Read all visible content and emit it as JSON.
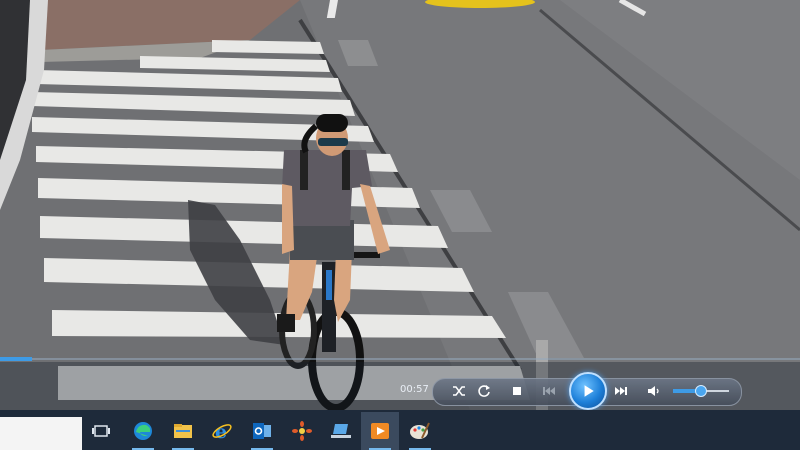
{
  "player": {
    "time": "00:57",
    "seek_fraction": 0.04,
    "volume_fraction": 0.48,
    "controls": [
      {
        "name": "shuffle-button",
        "icon": "shuffle-icon"
      },
      {
        "name": "repeat-button",
        "icon": "repeat-icon"
      },
      {
        "name": "stop-button",
        "icon": "stop-icon"
      },
      {
        "name": "previous-button",
        "icon": "previous-icon"
      },
      {
        "name": "play-button",
        "icon": "play-icon"
      },
      {
        "name": "next-button",
        "icon": "next-icon"
      },
      {
        "name": "mute-button",
        "icon": "speaker-icon"
      }
    ],
    "accent_color": "#3e9be6"
  },
  "taskbar": {
    "search_value": "",
    "apps": [
      {
        "name": "task-view",
        "icon": "task-view-icon"
      },
      {
        "name": "edge",
        "icon": "edge-icon"
      },
      {
        "name": "file-explorer",
        "icon": "folder-icon"
      },
      {
        "name": "internet-explorer",
        "icon": "ie-icon"
      },
      {
        "name": "outlook",
        "icon": "outlook-icon"
      },
      {
        "name": "app-flower",
        "icon": "flower-icon"
      },
      {
        "name": "app-laptop",
        "icon": "laptop-icon"
      },
      {
        "name": "media-player",
        "icon": "media-player-icon"
      },
      {
        "name": "paint",
        "icon": "paint-icon"
      }
    ],
    "background": "#1e2a3a"
  }
}
